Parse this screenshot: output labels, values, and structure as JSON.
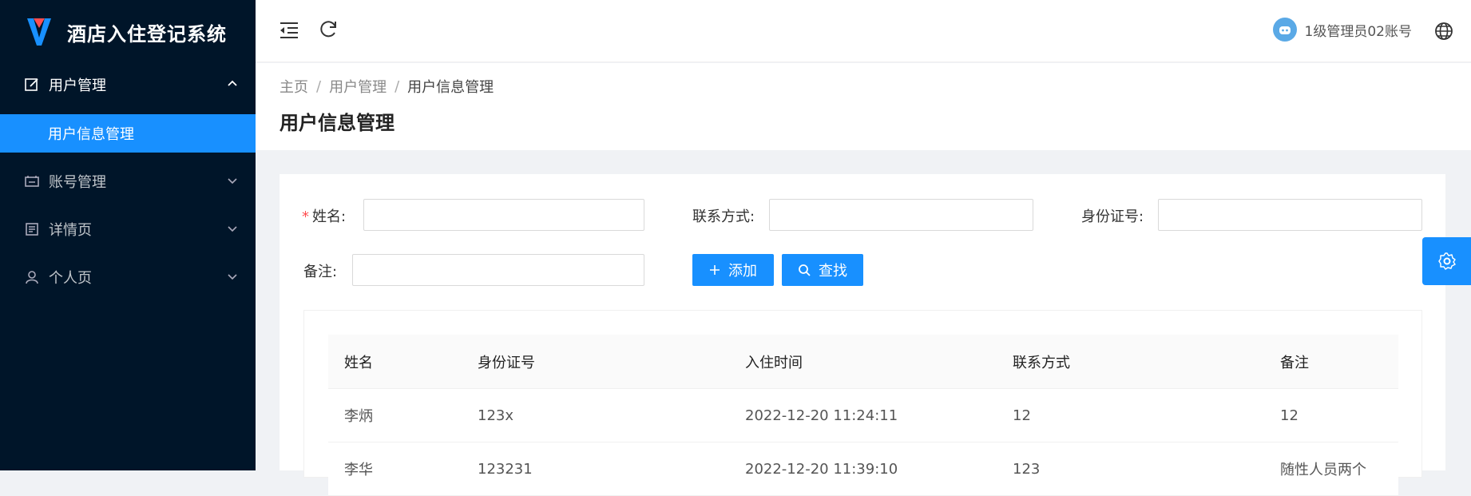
{
  "app": {
    "title": "酒店入住登记系统"
  },
  "sidebar": {
    "menus": [
      {
        "label": "用户管理"
      },
      {
        "label": "账号管理"
      },
      {
        "label": "详情页"
      },
      {
        "label": "个人页"
      }
    ],
    "submenu": {
      "label": "用户信息管理"
    }
  },
  "header": {
    "username": "1级管理员02账号"
  },
  "breadcrumb": [
    "主页",
    "用户管理",
    "用户信息管理"
  ],
  "page": {
    "title": "用户信息管理"
  },
  "form": {
    "name_label": "姓名:",
    "contact_label": "联系方式:",
    "id_label": "身份证号:",
    "note_label": "备注:",
    "name_value": "",
    "contact_value": "",
    "id_value": "",
    "note_value": ""
  },
  "buttons": {
    "add": "添加",
    "search": "查找"
  },
  "table": {
    "columns": [
      "姓名",
      "身份证号",
      "入住时间",
      "联系方式",
      "备注"
    ],
    "rows": [
      [
        "李炳",
        "123x",
        "2022-12-20 11:24:11",
        "12",
        "12"
      ],
      [
        "李华",
        "123231",
        "2022-12-20 11:39:10",
        "123",
        "随性人员两个"
      ]
    ]
  },
  "colors": {
    "sidebar_bg": "#001529",
    "accent": "#1890ff",
    "required": "#ff4d4f"
  }
}
